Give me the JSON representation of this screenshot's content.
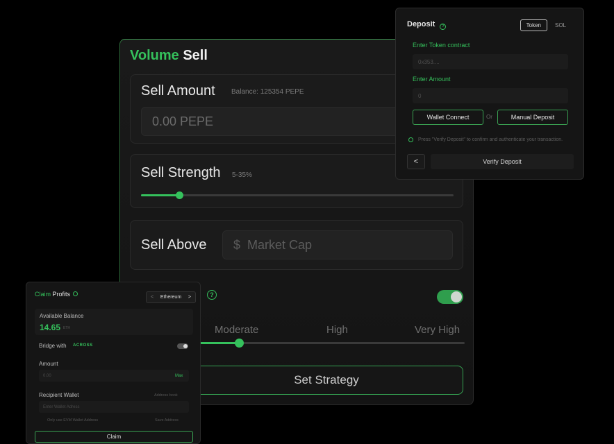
{
  "colors": {
    "accent": "#35c15c",
    "background": "#000000",
    "panel": "#171717"
  },
  "volume_sell": {
    "title_green": "Volume",
    "title_white": "Sell",
    "sell_amount": {
      "label": "Sell Amount",
      "balance": "Balance: 125354 PEPE",
      "input_placeholder": "0.00 PEPE"
    },
    "sell_strength": {
      "label": "Sell Strength",
      "range": "5-35%",
      "value_fraction": 0.12
    },
    "sell_above": {
      "label": "Sell Above",
      "currency": "$",
      "input_placeholder": "Market Cap"
    },
    "strategy": {
      "help": "?",
      "toggle_on": true,
      "levels": [
        "Moderate",
        "High",
        "Very High"
      ],
      "selected_level": "Moderate"
    },
    "set_strategy_label": "Set Strategy"
  },
  "deposit": {
    "title": "Deposit",
    "help": "?",
    "tabs": [
      {
        "label": "Token",
        "active": true
      },
      {
        "label": "SOL",
        "active": false
      }
    ],
    "token_contract_label": "Enter Token contract",
    "token_contract_value": "0x353....",
    "amount_label": "Enter Amount",
    "amount_value": "0",
    "wallet_connect_label": "Wallet Connect",
    "or_label": "Or",
    "manual_deposit_label": "Manual Deposit",
    "note": "Press \"Verify Deposit\" to confirm and authenticate your transaction.",
    "back_icon": "chevron-left-icon",
    "back_label": "<",
    "verify_label": "Verify Deposit"
  },
  "claim_profits": {
    "title_green": "Claim",
    "title_white": " Profits",
    "network": "Ethereum",
    "network_prev": "<",
    "network_next": ">",
    "available_balance_label": "Available Balance",
    "available_balance_value": "14.65",
    "balance_unit": "ETH",
    "bridge_label": "Bridge with",
    "bridge_brand": "ACROSS",
    "amount_label": "Amount",
    "amount_placeholder": "0.00",
    "max_label": "Max",
    "recipient_label": "Recipient Wallet",
    "address_book_label": "Address book",
    "recipient_placeholder": "Enter Wallet Adress",
    "evm_hint": "Only use EVM Wallet Address",
    "save_address_label": "Save Address",
    "claim_label": "Claim"
  }
}
